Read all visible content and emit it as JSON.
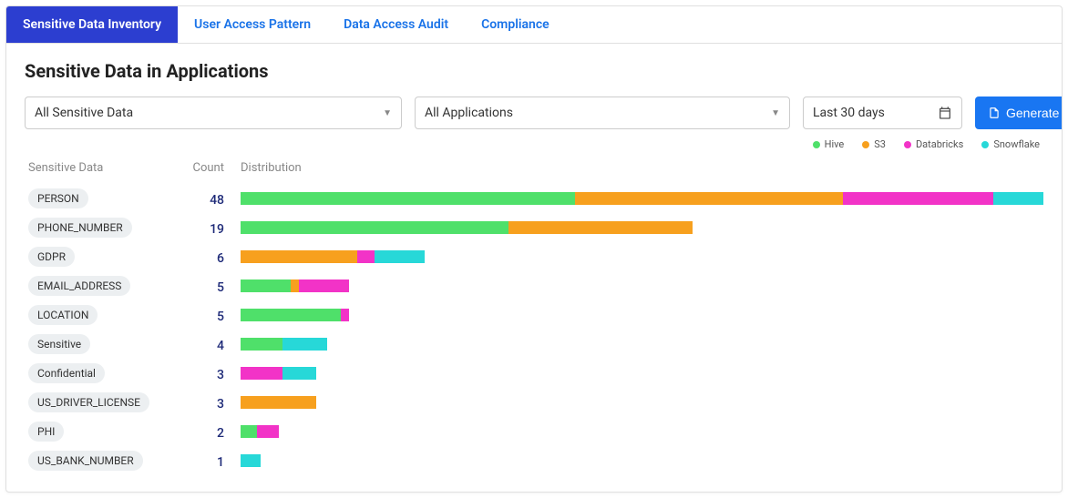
{
  "tabs": [
    {
      "label": "Sensitive Data Inventory",
      "active": true
    },
    {
      "label": "User Access Pattern",
      "active": false
    },
    {
      "label": "Data Access Audit",
      "active": false
    },
    {
      "label": "Compliance",
      "active": false
    }
  ],
  "page_title": "Sensitive Data in Applications",
  "filters": {
    "sensitive_data": "All Sensitive Data",
    "applications": "All Applications",
    "date_range": "Last 30 days"
  },
  "generate_label": "Generate",
  "legend": [
    {
      "name": "Hive",
      "color": "#4fe06a"
    },
    {
      "name": "S3",
      "color": "#f7a01e"
    },
    {
      "name": "Databricks",
      "color": "#f233c7"
    },
    {
      "name": "Snowflake",
      "color": "#27d8d8"
    }
  ],
  "headers": {
    "tag": "Sensitive Data",
    "count": "Count",
    "dist": "Distribution"
  },
  "chart_data": {
    "type": "bar",
    "title": "Sensitive Data in Applications",
    "xlabel": "Distribution",
    "ylabel": "Sensitive Data",
    "max": 48,
    "series_keys": [
      "hive",
      "s3",
      "databricks",
      "snowflake"
    ],
    "rows": [
      {
        "tag": "PERSON",
        "count": 48,
        "dist": {
          "hive": 20,
          "s3": 16,
          "databricks": 9,
          "snowflake": 3
        }
      },
      {
        "tag": "PHONE_NUMBER",
        "count": 19,
        "dist": {
          "hive": 16,
          "s3": 11,
          "databricks": 0,
          "snowflake": 0
        }
      },
      {
        "tag": "GDPR",
        "count": 6,
        "dist": {
          "hive": 0,
          "s3": 7,
          "databricks": 1,
          "snowflake": 3
        }
      },
      {
        "tag": "EMAIL_ADDRESS",
        "count": 5,
        "dist": {
          "hive": 3,
          "s3": 0.5,
          "databricks": 3,
          "snowflake": 0
        }
      },
      {
        "tag": "LOCATION",
        "count": 5,
        "dist": {
          "hive": 6,
          "s3": 0,
          "databricks": 0.5,
          "snowflake": 0
        }
      },
      {
        "tag": "Sensitive",
        "count": 4,
        "dist": {
          "hive": 2.5,
          "s3": 0,
          "databricks": 0,
          "snowflake": 2.7
        }
      },
      {
        "tag": "Confidential",
        "count": 3,
        "dist": {
          "hive": 0,
          "s3": 0,
          "databricks": 2.5,
          "snowflake": 2
        }
      },
      {
        "tag": "US_DRIVER_LICENSE",
        "count": 3,
        "dist": {
          "hive": 0,
          "s3": 4.5,
          "databricks": 0,
          "snowflake": 0
        }
      },
      {
        "tag": "PHI",
        "count": 2,
        "dist": {
          "hive": 1,
          "s3": 0,
          "databricks": 1.3,
          "snowflake": 0
        }
      },
      {
        "tag": "US_BANK_NUMBER",
        "count": 1,
        "dist": {
          "hive": 0,
          "s3": 0,
          "databricks": 0,
          "snowflake": 1.2
        }
      }
    ]
  }
}
